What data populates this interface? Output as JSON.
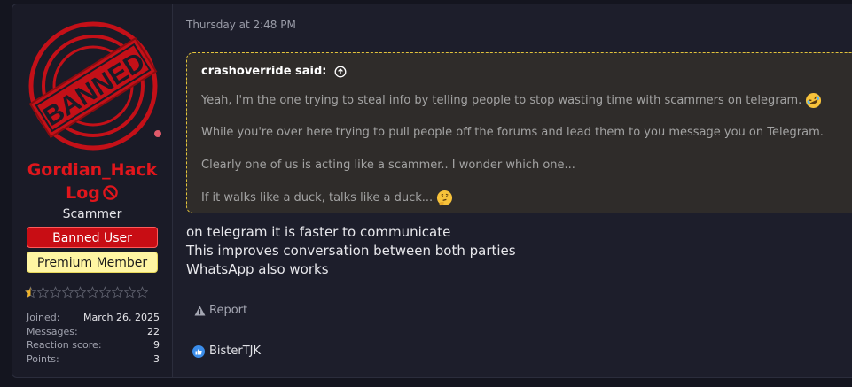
{
  "user": {
    "name": "Gordian_HackLog",
    "title": "Scammer",
    "banners": [
      "Banned User",
      "Premium Member"
    ],
    "avatar_stamp": "BANNED",
    "rating": {
      "filled": 0.5,
      "max": 10
    },
    "stats": [
      {
        "label": "Joined:",
        "value": "March 26, 2025"
      },
      {
        "label": "Messages:",
        "value": "22"
      },
      {
        "label": "Reaction score:",
        "value": "9"
      },
      {
        "label": "Points:",
        "value": "3"
      }
    ]
  },
  "post": {
    "date": "Thursday at 2:48 PM",
    "quote": {
      "author_label": "crashoverride said:",
      "lines": [
        "Yeah, I'm the one trying to steal info by telling people to stop wasting time with scammers on telegram.",
        "While you're over here trying to pull people off the forums and lead them to you message you on Telegram.",
        "Clearly one of us is acting like a scammer.. I wonder which one...",
        "If it walks like a duck, talks like a duck..."
      ],
      "line_emojis": [
        "rofl-emoji",
        "",
        "",
        "thinking-emoji"
      ]
    },
    "message_lines": [
      "on telegram it is faster to communicate",
      "This improves conversation between both parties",
      "WhatsApp also works"
    ],
    "report_label": "Report",
    "reaction_users": "BisterTJK"
  },
  "colors": {
    "username": "#e0161c",
    "banned_banner": "#c80d14",
    "premium_banner": "#fff6a3",
    "quote_border": "#e2c33c",
    "like": "#3b8dea"
  },
  "icons": [
    "ban-icon",
    "arrow-up-circle-icon",
    "warning-icon",
    "like-icon",
    "star-icon"
  ]
}
